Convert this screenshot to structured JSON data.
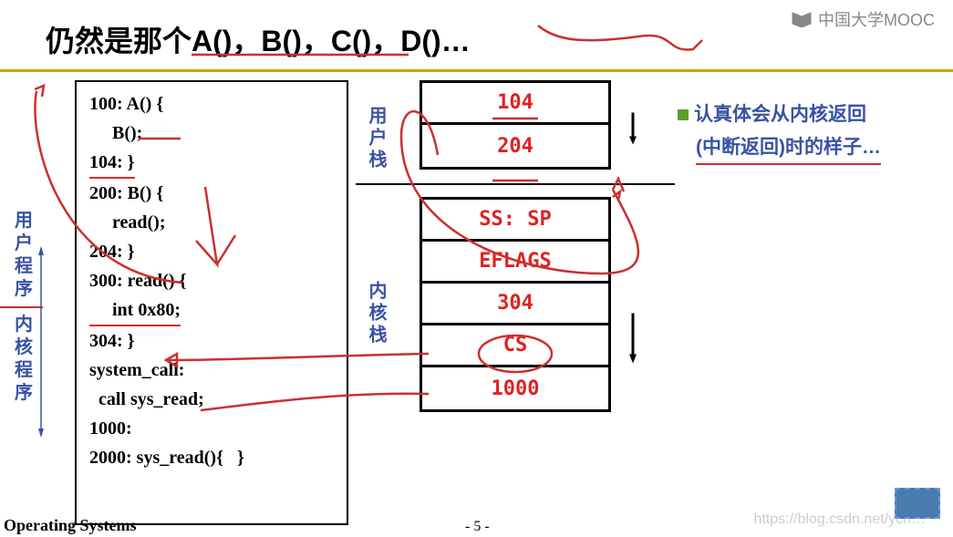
{
  "watermark": "中国大学MOOC",
  "title": "仍然是那个A()，B()，C()，D()…",
  "left_labels": {
    "user_program": "用户程序",
    "kernel_program": "内核程序"
  },
  "code": {
    "l1": "100: A() {",
    "l2": "     B();",
    "l3": "104: }",
    "l4": "200: B() {",
    "l5": "     read();",
    "l6": "204: }",
    "l7": "300: read() {",
    "l8": "     int 0x80;",
    "l9": "304: }",
    "l10": "system_call:",
    "l11": "  call sys_read;",
    "l12": "1000:",
    "l13": "2000: sys_read(){   }"
  },
  "stacks": {
    "user_label": "用户栈",
    "kernel_label": "内核栈",
    "user_cells": [
      "104",
      "204"
    ],
    "kernel_cells": [
      "SS: SP",
      "EFLAGS",
      "304",
      "CS",
      "1000"
    ]
  },
  "note": {
    "line1": "认真体会从内核返回",
    "line2": "(中断返回)时的样子…"
  },
  "footer": "Operating Systems",
  "page": "- 5 -",
  "csdn": "https://blog.csdn.net/ych…"
}
